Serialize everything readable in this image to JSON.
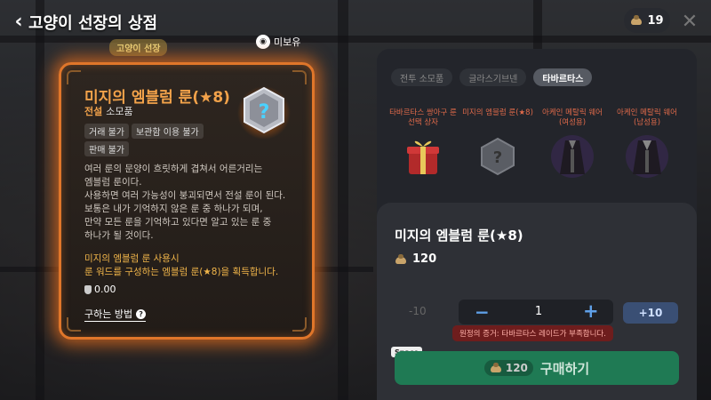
{
  "header": {
    "title": "고양이 선장의 상점",
    "currency_amount": "19"
  },
  "shop_tag": "고양이 선장",
  "unowned_label": "미보유",
  "item_card": {
    "title": "미지의 엠블럼 룬(★8)",
    "rarity": "전설",
    "category": "소모품",
    "tags": [
      "거래 불가",
      "보관함 이용 불가",
      "판매 불가"
    ],
    "description": [
      "여러 룬의 문양이 흐릿하게 겹쳐서 어른거리는",
      "엠블럼 룬이다.",
      "사용하면 여러 가능성이 붕괴되면서 전설 룬이 된다.",
      "보통은 내가 기억하지 않은 룬 중 하나가 되며,",
      "만약 모든 룬을 기억하고 있다면 알고 있는 룬 중",
      "하나가 될 것이다."
    ],
    "effect": [
      "미지의 엠블럼 룬 사용시",
      "룬 워드를 구성하는 엠블럼 룬(★8)을 획득합니다."
    ],
    "sell_price": "0.00",
    "how_to_obtain": "구하는 방법"
  },
  "tabs": [
    {
      "label": "전투 소모품",
      "active": false
    },
    {
      "label": "글라스기브넨",
      "active": false
    },
    {
      "label": "타바르타스",
      "active": true
    }
  ],
  "goods": [
    {
      "name": "타바르타스 쌍아구 룬 선택 상자",
      "icon": "gift-box-icon"
    },
    {
      "name": "미지의 엠블럼 룬(★8)",
      "icon": "mystery-rune-icon"
    },
    {
      "name": "아케인 메탈릭 웨어 (여성용)",
      "icon": "coat-icon"
    },
    {
      "name": "아케인 메탈릭 웨어 (남성용)",
      "icon": "coat-icon"
    }
  ],
  "purchase": {
    "title": "미지의 엠블럼 룬(★8)",
    "price": "120",
    "minus10": "-10",
    "minus": "−",
    "quantity": "1",
    "plus": "+",
    "plus10": "+10",
    "warning": "원정의 증거: 타바르타스 레이드가 부족합니다.",
    "hotkey": "Space",
    "buy_cost": "120",
    "buy_label": "구매하기"
  },
  "colors": {
    "accent_orange": "#e0762a",
    "legend_text": "#f2a24a",
    "buy_green": "#1f7a54",
    "stepper_blue": "#5fa0e8"
  }
}
